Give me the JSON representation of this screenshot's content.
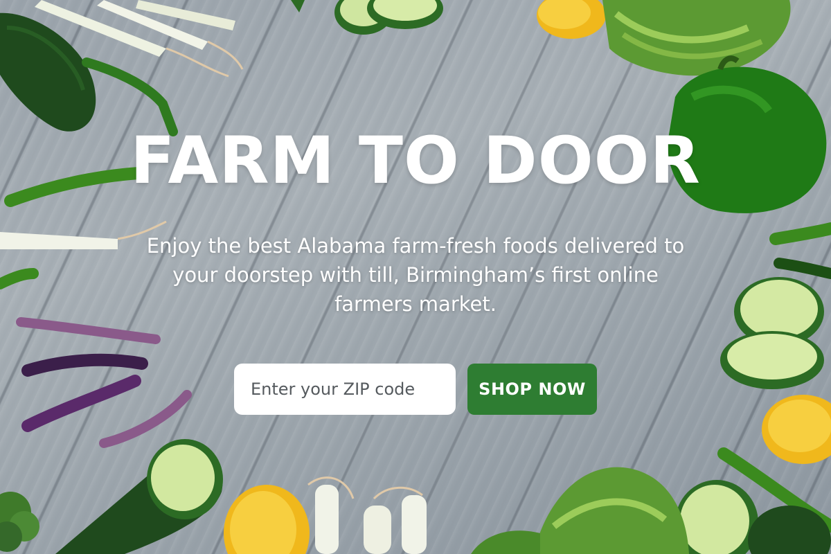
{
  "hero": {
    "title": "FARM TO DOOR",
    "subtitle": "Enjoy the best Alabama farm-fresh foods delivered to your doorstep with till, Birmingham’s first online farmers market."
  },
  "zip_form": {
    "placeholder": "Enter your ZIP code",
    "value": ""
  },
  "cta": {
    "label": "SHOP NOW"
  },
  "colors": {
    "button_green": "#2e7d32",
    "text_white": "#ffffff",
    "wood_gray": "#a8b0b6"
  }
}
